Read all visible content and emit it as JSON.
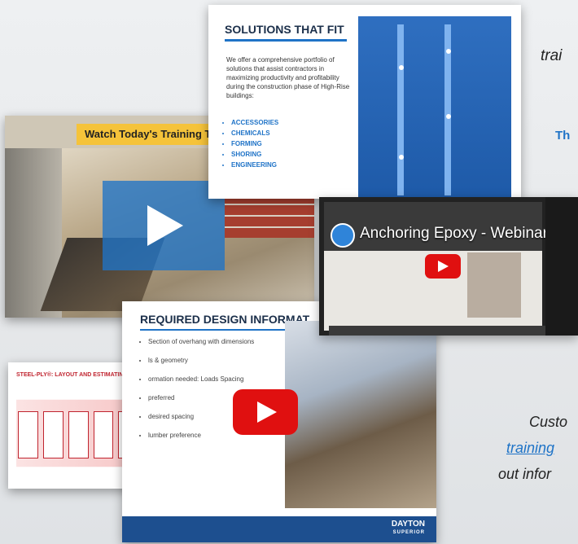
{
  "side_text": {
    "line1": "trai",
    "line2": "Th",
    "custom_line1": "Custo",
    "custom_line2": "training",
    "custom_line3": "out infor"
  },
  "slide_photo": {
    "banner": "Watch Today's Training T"
  },
  "slide_solutions": {
    "title": "SOLUTIONS THAT FIT",
    "body": "We offer a comprehensive portfolio of solutions that assist contractors in maximizing productivity and profitability during the construction phase of High-Rise buildings:",
    "items": [
      "ACCESSORIES",
      "CHEMICALS",
      "FORMING",
      "SHORING",
      "ENGINEERING"
    ]
  },
  "slide_webinar": {
    "title": "Anchoring Epoxy - Webinar"
  },
  "slide_design": {
    "title": "REQUIRED DESIGN INFORMAT",
    "bullets": [
      "Section of overhang with dimensions",
      "ls & geometry",
      "ormation needed: Loads Spacing",
      "preferred",
      "desired spacing",
      "lumber preference"
    ],
    "brand": "DAYTON",
    "brand_sub": "SUPERIOR"
  },
  "slide_layout": {
    "title": "STEEL-PLY®: LAYOUT AND ESTIMATING"
  },
  "colors": {
    "accent_blue": "#1f73c7",
    "brand_navy": "#1d4f8f",
    "youtube_red": "#e01010",
    "banner_yellow": "#f5c33a"
  },
  "icons": [
    "play-icon",
    "youtube-play-icon"
  ]
}
